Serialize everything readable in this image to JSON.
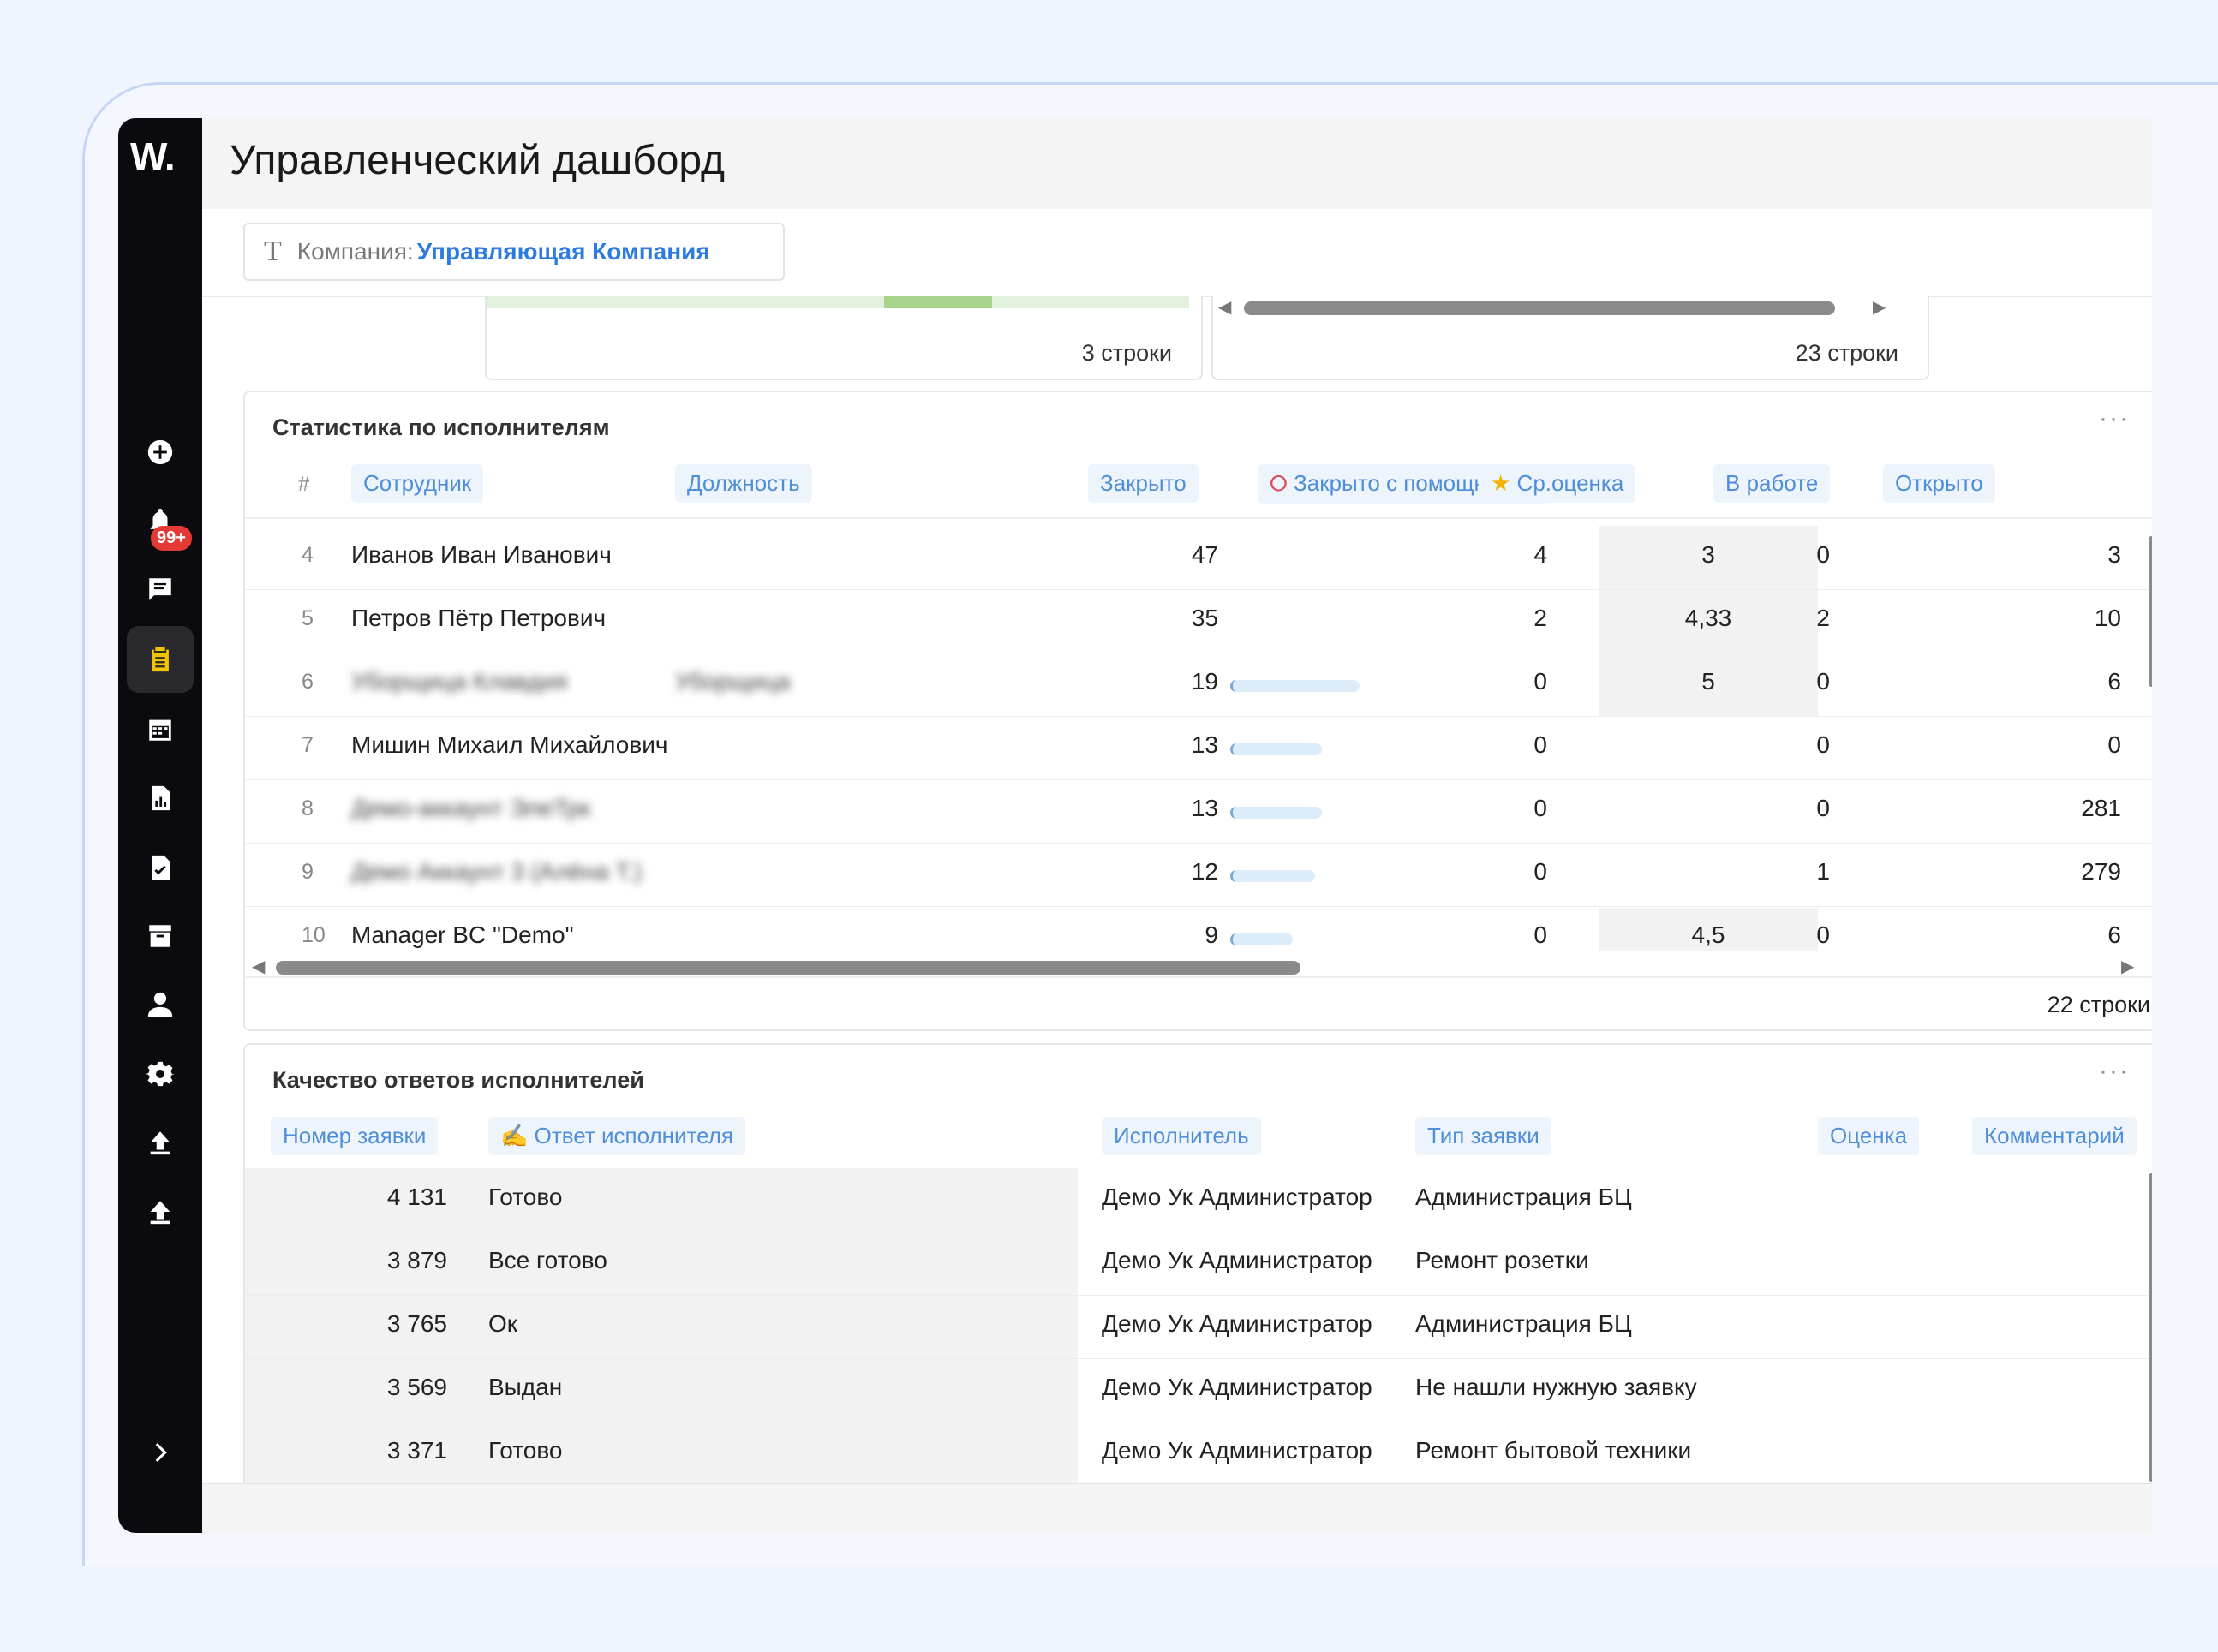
{
  "app": {
    "logo": "W.",
    "title": "Управленческий дашборд",
    "notification_badge": "99+"
  },
  "filter": {
    "icon": "T",
    "label": "Компания:",
    "value": "Управляющая Компания"
  },
  "previous_cards": [
    {
      "count": "3 строки"
    },
    {
      "count": "23 строки"
    }
  ],
  "performers": {
    "title": "Статистика по исполнителям",
    "menu": "···",
    "hash": "#",
    "columns": {
      "employee": "Сотрудник",
      "position": "Должность",
      "closed": "Закрыто",
      "closed_with_helper": "Закрыто с помощником",
      "avg_rating": "Ср.оценка",
      "in_work": "В работе",
      "open": "Открыто"
    },
    "rows": [
      {
        "n": "4",
        "name": "Иванов Иван Иванович",
        "position": "",
        "closed": "47",
        "helper": "4",
        "rating": "3",
        "in_work": "0",
        "open": "3"
      },
      {
        "n": "5",
        "name": "Петров Пётр Петрович",
        "position": "",
        "closed": "35",
        "helper": "2",
        "rating": "4,33",
        "in_work": "2",
        "open": "10"
      },
      {
        "n": "6",
        "name": "Уборщица Клавдия",
        "position": "Уборщица",
        "closed": "19",
        "helper": "0",
        "rating": "5",
        "in_work": "0",
        "open": "6"
      },
      {
        "n": "7",
        "name": "Мишин Михаил Михайлович",
        "position": "",
        "closed": "13",
        "helper": "0",
        "rating": "",
        "in_work": "0",
        "open": "0"
      },
      {
        "n": "8",
        "name": "Демо-аккаунт ЭлеТрк",
        "position": "",
        "closed": "13",
        "helper": "0",
        "rating": "",
        "in_work": "0",
        "open": "281"
      },
      {
        "n": "9",
        "name": "Демо Аккаунт 3 (Алёна Т.)",
        "position": "",
        "closed": "12",
        "helper": "0",
        "rating": "",
        "in_work": "1",
        "open": "279"
      },
      {
        "n": "10",
        "name": "Manager BC \"Demo\"",
        "position": "",
        "closed": "9",
        "helper": "0",
        "rating": "4,5",
        "in_work": "0",
        "open": "6"
      }
    ],
    "closed_fraction": [
      null,
      null,
      0.4,
      0.28,
      0.28,
      0.26,
      0.19
    ],
    "footer_count": "22 строки"
  },
  "quality": {
    "title": "Качество ответов исполнителей",
    "menu": "···",
    "columns": {
      "ticket_number": "Номер заявки",
      "answer": "Ответ исполнителя",
      "performer": "Исполнитель",
      "type": "Тип заявки",
      "rating": "Оценка",
      "comment": "Комментарий"
    },
    "rows": [
      {
        "number": "4 131",
        "answer": "Готово",
        "performer": "Демо Ук Администратор",
        "type": "Администрация БЦ"
      },
      {
        "number": "3 879",
        "answer": "Все готово",
        "performer": "Демо Ук Администратор",
        "type": "Ремонт розетки"
      },
      {
        "number": "3 765",
        "answer": "Ок",
        "performer": "Демо Ук Администратор",
        "type": "Администрация БЦ"
      },
      {
        "number": "3 569",
        "answer": "Выдан",
        "performer": "Демо Ук Администратор",
        "type": "Не нашли нужную заявку"
      },
      {
        "number": "3 371",
        "answer": "Готово",
        "performer": "Демо Ук Администратор",
        "type": "Ремонт бытовой техники"
      }
    ]
  },
  "colors": {
    "sidebar": "#0b0b0f",
    "accent": "#2d7be0",
    "header_chip_bg": "#eef4fb",
    "bar": "#dcecf8"
  }
}
